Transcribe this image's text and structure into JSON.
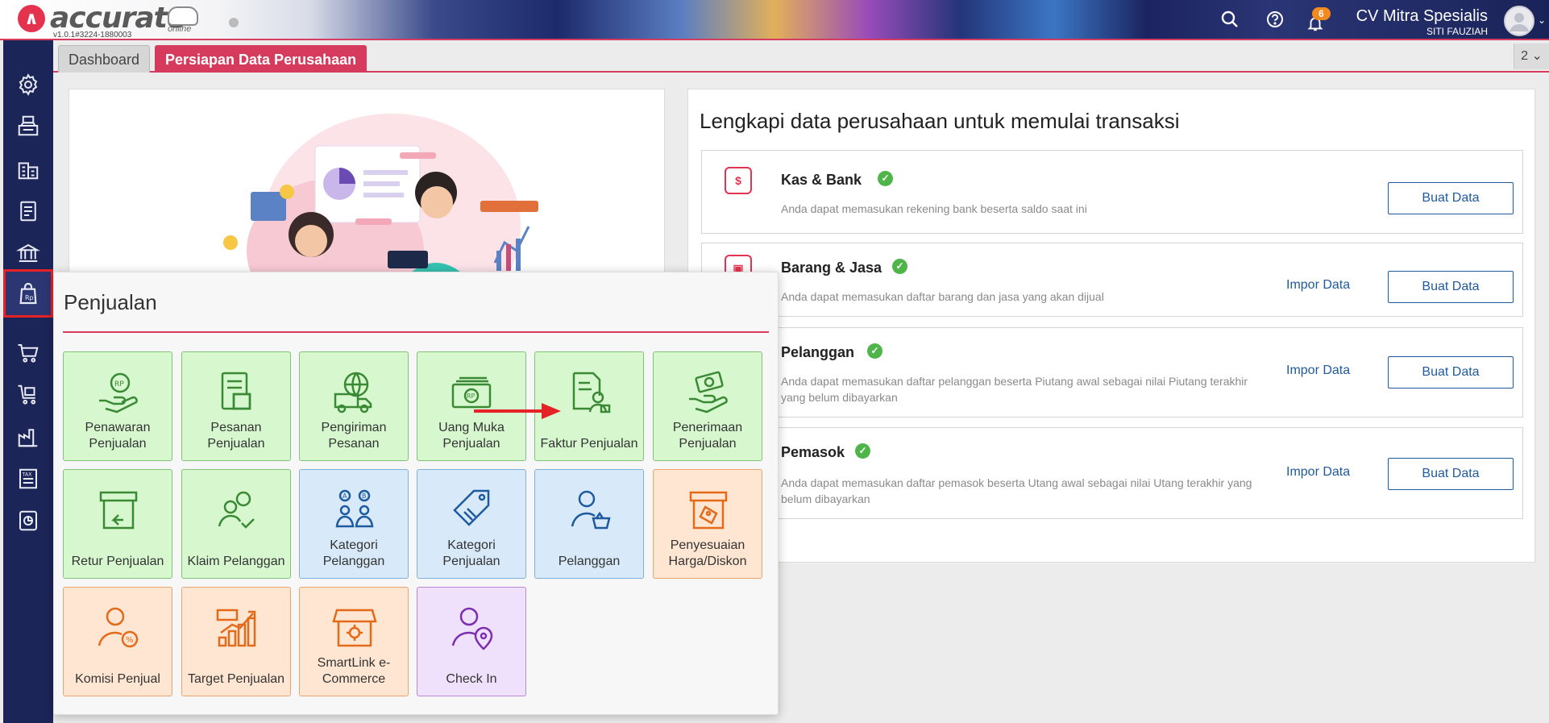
{
  "header": {
    "brand": "accurate",
    "brand_sub": "online",
    "version": "v1.0.1#3224-1880003",
    "notification_count": "6",
    "company": "CV Mitra Spesialis",
    "user": "SITI FAUZIAH",
    "icons": [
      "search-icon",
      "help-icon",
      "bell-icon",
      "avatar"
    ]
  },
  "sidebar": {
    "items": [
      {
        "icon": "gear-icon"
      },
      {
        "icon": "cash-register-icon"
      },
      {
        "icon": "buildings-icon"
      },
      {
        "icon": "ledger-icon"
      },
      {
        "icon": "bank-icon"
      },
      {
        "icon": "sales-bag-icon",
        "active": true
      },
      {
        "icon": "cart-icon"
      },
      {
        "icon": "cart-box-icon"
      },
      {
        "icon": "factory-icon"
      },
      {
        "icon": "tax-doc-icon"
      },
      {
        "icon": "report-chart-icon"
      }
    ]
  },
  "tabs": {
    "items": [
      {
        "label": "Dashboard"
      },
      {
        "label": "Persiapan Data Perusahaan"
      }
    ],
    "more_label": "2 ⌄"
  },
  "setup": {
    "title": "Lengkapi data perusahaan untuk memulai transaksi",
    "impor_label": "Impor Data",
    "buat_label": "Buat Data",
    "rows": [
      {
        "title": "Kas & Bank",
        "desc": "Anda dapat memasukan rekening bank beserta saldo saat ini"
      },
      {
        "title": "Barang & Jasa",
        "desc": "Anda dapat memasukan daftar barang dan jasa yang akan dijual"
      },
      {
        "title": "Pelanggan",
        "desc": "Anda dapat memasukan daftar pelanggan beserta Piutang awal sebagai nilai Piutang terakhir yang belum dibayarkan"
      },
      {
        "title": "Pemasok",
        "desc": "Anda dapat memasukan daftar pemasok beserta Utang awal sebagai nilai Utang terakhir yang belum dibayarkan"
      }
    ]
  },
  "popup": {
    "title": "Penjualan",
    "tiles": [
      {
        "label": "Penawaran Penjualan",
        "color": "green",
        "icon": "hand-rp-icon"
      },
      {
        "label": "Pesanan Penjualan",
        "color": "green",
        "icon": "order-doc-icon"
      },
      {
        "label": "Pengiriman Pesanan",
        "color": "green",
        "icon": "delivery-truck-icon"
      },
      {
        "label": "Uang Muka Penjualan",
        "color": "green",
        "icon": "cash-rp-icon"
      },
      {
        "label": "Faktur Penjualan",
        "color": "green",
        "icon": "invoice-user-icon"
      },
      {
        "label": "Penerimaan Penjualan",
        "color": "green",
        "icon": "money-hand-icon"
      },
      {
        "label": "Retur Penjualan",
        "color": "green",
        "icon": "return-box-icon"
      },
      {
        "label": "Klaim Pelanggan",
        "color": "green",
        "icon": "user-check-icon"
      },
      {
        "label": "Kategori Pelanggan",
        "color": "blue",
        "icon": "user-category-icon"
      },
      {
        "label": "Kategori Penjualan",
        "color": "blue",
        "icon": "tag-icon"
      },
      {
        "label": "Pelanggan",
        "color": "blue",
        "icon": "customer-basket-icon"
      },
      {
        "label": "Penyesuaian Harga/Diskon",
        "color": "orange",
        "icon": "price-adjust-icon"
      },
      {
        "label": "Komisi Penjual",
        "color": "orange",
        "icon": "user-percent-icon"
      },
      {
        "label": "Target Penjualan",
        "color": "orange",
        "icon": "target-chart-icon"
      },
      {
        "label": "SmartLink e-Commerce",
        "color": "orange",
        "icon": "store-gear-icon"
      },
      {
        "label": "Check In",
        "color": "purple",
        "icon": "user-location-icon"
      }
    ]
  },
  "colors": {
    "accent": "#d63a5c",
    "sidebar": "#1c2557",
    "link": "#1e5a9e",
    "check": "#4fb54a",
    "active_outline": "#e52226",
    "arrow": "#e52226"
  }
}
